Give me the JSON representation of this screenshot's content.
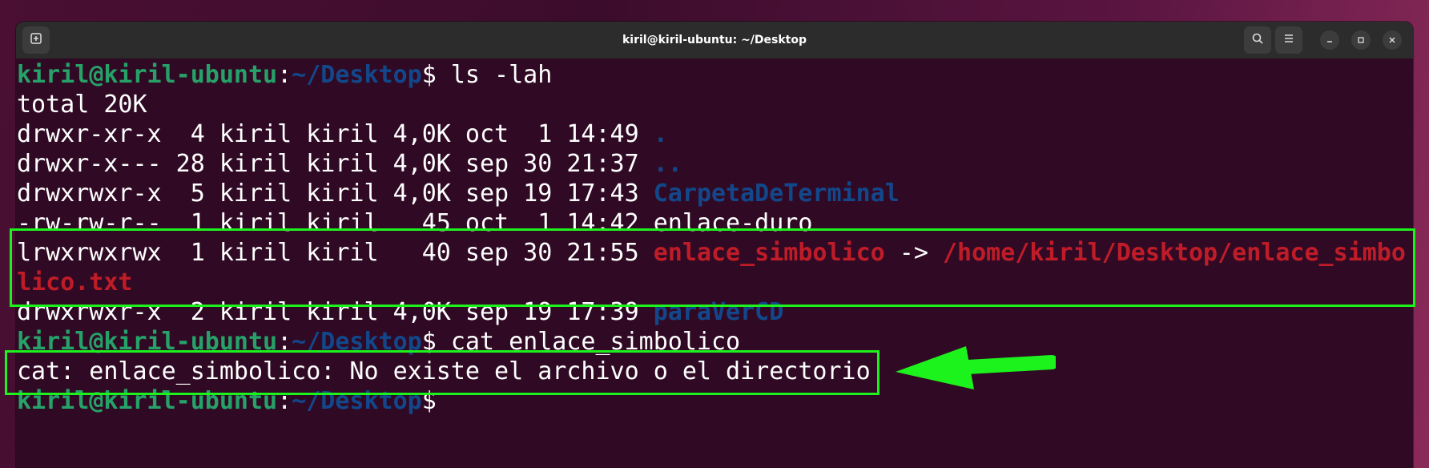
{
  "window": {
    "title": "kiril@kiril-ubuntu: ~/Desktop"
  },
  "titlebar": {
    "new_tab_icon": "new-tab-icon",
    "search_icon": "search-icon",
    "menu_icon": "hamburger-menu-icon",
    "minimize_icon": "minimize-icon",
    "maximize_icon": "maximize-icon",
    "close_icon": "close-icon"
  },
  "colors": {
    "background": "#300a24",
    "prompt_user": "#26a269",
    "prompt_path": "#12488b",
    "directory": "#12488b",
    "broken_link": "#c01c28",
    "annotation": "#1cf21c"
  },
  "terminal": {
    "prompt1": {
      "user": "kiril@kiril-ubuntu",
      "sep": ":",
      "path": "~/Desktop",
      "symbol": "$",
      "command": " ls -lah"
    },
    "total": "total 20K",
    "entries": [
      {
        "meta": "drwxr-xr-x  4 kiril kiril 4,0K oct  1 14:49 ",
        "name": "."
      },
      {
        "meta": "drwxr-x--- 28 kiril kiril 4,0K sep 30 21:37 ",
        "name": ".."
      },
      {
        "meta": "drwxrwxr-x  5 kiril kiril 4,0K sep 19 17:43 ",
        "name": "CarpetaDeTerminal"
      },
      {
        "meta": "-rw-rw-r--  1 kiril kiril   45 oct  1 14:42 ",
        "name": "enlace-duro"
      },
      {
        "meta": "lrwxrwxrwx  1 kiril kiril   40 sep 30 21:55 ",
        "name": "enlace_simbolico",
        "arrow": " -> ",
        "target_part1": "/home/kiril/Desktop/enlace_simbo",
        "target_part2": "lico.txt"
      },
      {
        "meta": "drwxrwxr-x  2 kiril kiril 4,0K sep 19 17:39 ",
        "name": "paraVerCD"
      }
    ],
    "prompt2": {
      "user": "kiril@kiril-ubuntu",
      "sep": ":",
      "path": "~/Desktop",
      "symbol": "$",
      "command": " cat enlace_simbolico"
    },
    "error": "cat: enlace_simbolico: No existe el archivo o el directorio",
    "prompt3": {
      "user": "kiril@kiril-ubuntu",
      "sep": ":",
      "path": "~/Desktop",
      "symbol": "$"
    }
  }
}
